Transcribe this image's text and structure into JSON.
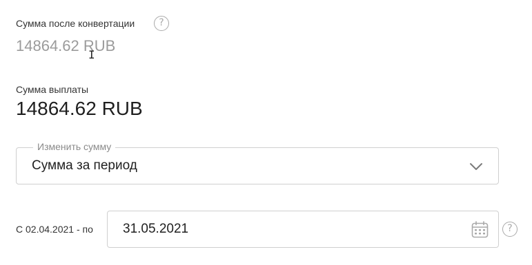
{
  "converted": {
    "label": "Сумма после конвертации",
    "value": "14864.62 RUB",
    "help_glyph": "?"
  },
  "payout": {
    "label": "Сумма выплаты",
    "value": "14864.62 RUB"
  },
  "change_amount": {
    "legend": "Изменить сумму",
    "selected_value": "Сумма за период",
    "icon": "chevron-down-icon"
  },
  "period": {
    "prefix": "С 02.04.2021 - по",
    "end_date": "31.05.2021",
    "calendar_icon": "calendar-icon",
    "help_glyph": "?"
  },
  "colors": {
    "text_primary": "#1f1f1f",
    "text_muted": "#9b9b9b",
    "border": "#cfcfcf",
    "icon": "#a9a9a9"
  }
}
